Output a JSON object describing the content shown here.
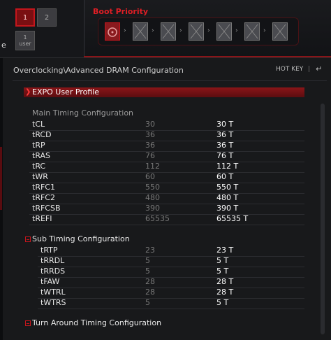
{
  "profiles": {
    "p1": "1",
    "p2": "2",
    "user_num": "1",
    "user_label": "user"
  },
  "edge_letter": "e",
  "boot_priority": {
    "title": "Boot Priority",
    "device_count": 7
  },
  "header": {
    "path": "Overclocking\\Advanced DRAM Configuration",
    "hotkey": "HOT KEY",
    "separator": "|",
    "back_icon": "↵"
  },
  "expo": {
    "arrow": "❯",
    "label": "EXPO User Profile"
  },
  "main_timing": {
    "title": "Main Timing Configuration",
    "rows": [
      {
        "name": "tCL",
        "auto": "30",
        "value": "30 T"
      },
      {
        "name": "tRCD",
        "auto": "36",
        "value": "36 T"
      },
      {
        "name": "tRP",
        "auto": "36",
        "value": "36 T"
      },
      {
        "name": "tRAS",
        "auto": "76",
        "value": "76 T"
      },
      {
        "name": "tRC",
        "auto": "112",
        "value": "112 T"
      },
      {
        "name": "tWR",
        "auto": "60",
        "value": "60 T"
      },
      {
        "name": "tRFC1",
        "auto": "550",
        "value": "550 T"
      },
      {
        "name": "tRFC2",
        "auto": "480",
        "value": "480 T"
      },
      {
        "name": "tRFCSB",
        "auto": "390",
        "value": "390 T"
      },
      {
        "name": "tREFI",
        "auto": "65535",
        "value": "65535 T"
      }
    ]
  },
  "sub_timing": {
    "title": "Sub Timing Configuration",
    "rows": [
      {
        "name": "tRTP",
        "auto": "23",
        "value": "23 T"
      },
      {
        "name": "tRRDL",
        "auto": "5",
        "value": "5 T"
      },
      {
        "name": "tRRDS",
        "auto": "5",
        "value": "5 T"
      },
      {
        "name": "tFAW",
        "auto": "28",
        "value": "28 T"
      },
      {
        "name": "tWTRL",
        "auto": "28",
        "value": "28 T"
      },
      {
        "name": "tWTRS",
        "auto": "5",
        "value": "5 T"
      }
    ]
  },
  "turnaround": {
    "title": "Turn Around Timing Configuration"
  },
  "colors": {
    "accent": "#c4161c",
    "background": "#18191b"
  }
}
